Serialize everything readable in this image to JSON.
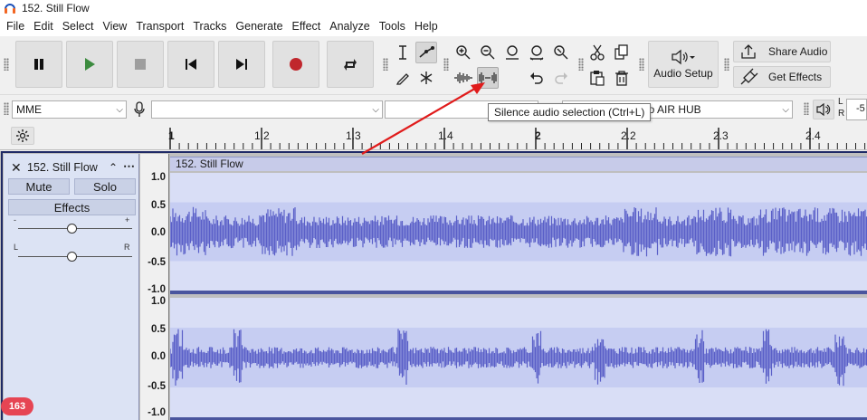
{
  "window": {
    "title": "152. Still Flow"
  },
  "menu": [
    "File",
    "Edit",
    "Select",
    "View",
    "Transport",
    "Tracks",
    "Generate",
    "Effect",
    "Analyze",
    "Tools",
    "Help"
  ],
  "toolbar": {
    "audio_setup_label": "Audio Setup",
    "share_audio_label": "Share Audio",
    "get_effects_label": "Get Effects"
  },
  "devices": {
    "host": "MME",
    "recording_device": "",
    "recording_channels": "",
    "playback_device": "io AIR HUB",
    "meter_l": "L",
    "meter_r": "R",
    "meter_value": "-5"
  },
  "tooltip": {
    "text": "Silence audio selection (Ctrl+L)"
  },
  "ruler": {
    "ticks": [
      "1",
      "1.2",
      "1.3",
      "1.4",
      "2",
      "2.2",
      "2.3",
      "2.4"
    ]
  },
  "track": {
    "name": "152. Still Flow",
    "mute_label": "Mute",
    "solo_label": "Solo",
    "effects_label": "Effects",
    "gain_minus": "-",
    "gain_plus": "+",
    "pan_left": "L",
    "pan_right": "R",
    "clip_name": "152. Still Flow"
  },
  "vertical_ruler": {
    "channel1": [
      "1.0",
      "0.5",
      "0.0",
      "-0.5",
      "-1.0"
    ],
    "channel2": [
      "1.0",
      "0.5",
      "0.0",
      "-0.5",
      "-1.0"
    ]
  },
  "badge": {
    "count": "163"
  },
  "colors": {
    "waveform": "#5a5fc8",
    "waveform_bg": "#d9def6",
    "waveform_band": "#c6cdf2",
    "accent_record": "#c0272d",
    "accent_play": "#3c8b3f",
    "annotation_arrow": "#e01b1b"
  }
}
